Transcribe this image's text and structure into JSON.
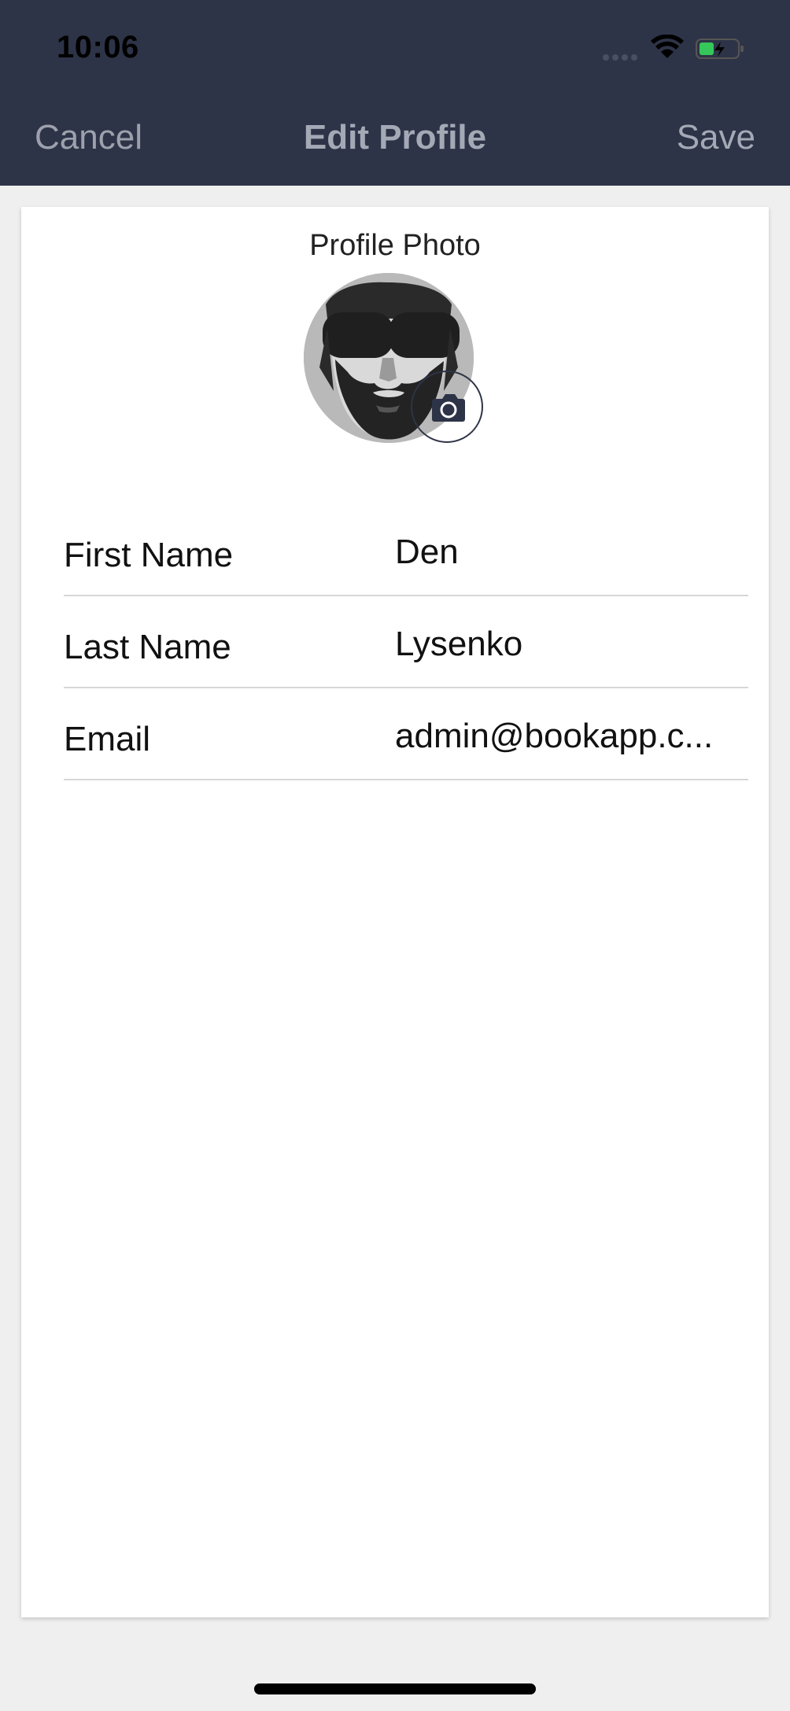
{
  "status_bar": {
    "time": "10:06"
  },
  "navbar": {
    "cancel_label": "Cancel",
    "title": "Edit Profile",
    "save_label": "Save",
    "background_color": "#2e3447"
  },
  "profile": {
    "photo_label": "Profile Photo",
    "avatar_icon": "bearded-man-sunglasses-avatar",
    "camera_icon": "camera-icon"
  },
  "fields": [
    {
      "label": "First Name",
      "value": "Den"
    },
    {
      "label": "Last Name",
      "value": "Lysenko"
    },
    {
      "label": "Email",
      "value": "admin@bookapp.c..."
    }
  ]
}
